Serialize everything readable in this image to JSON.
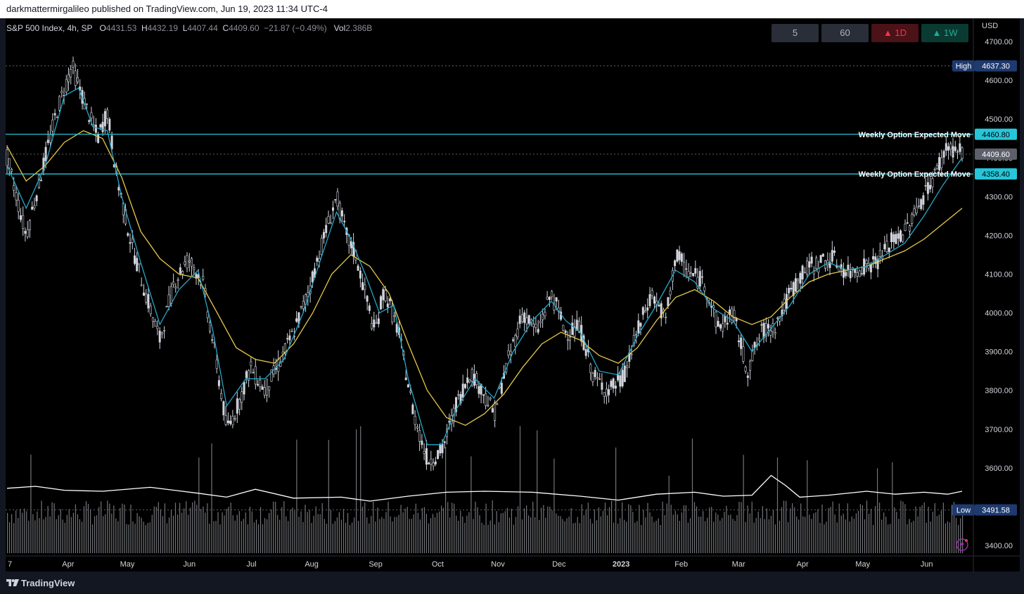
{
  "header": {
    "published_text": "darkmattermirgalileo published on TradingView.com, Jun 19, 2023 11:34 UTC-4"
  },
  "legend": {
    "symbol": "S&P 500 Index, 4h, SP",
    "o_label": "O",
    "o_value": "4431.53",
    "h_label": "H",
    "h_value": "4432.19",
    "l_label": "L",
    "l_value": "4407.44",
    "c_label": "C",
    "c_value": "4409.60",
    "change": "−21.87 (−0.49%)",
    "vol_label": "Vol",
    "vol_value": "2.386B"
  },
  "timeframe_buttons": [
    {
      "label": "5",
      "bg": "#2a2e39",
      "color": "#b2b5be"
    },
    {
      "label": "60",
      "bg": "#2a2e39",
      "color": "#b2b5be"
    },
    {
      "label": "▲ 1D",
      "bg": "#4b1218",
      "color": "#f23645"
    },
    {
      "label": "▲ 1W",
      "bg": "#0b3a33",
      "color": "#22ab94"
    }
  ],
  "currency": "USD",
  "footer": {
    "logo_text": "TradingView"
  },
  "colors": {
    "candle": "#d1d4dc",
    "ema_fast": "#26a6c9",
    "sma_slow": "#e6c84a",
    "expected_move": "#26c6da",
    "volume": "#d1d4dc",
    "volume_ma": "#ffffff"
  },
  "chart_data": {
    "type": "candlestick",
    "title": "S&P 500 Index, 4h, SP",
    "ylim": [
      3380,
      4760
    ],
    "y_ticks": [
      4700,
      4600,
      4500,
      4400,
      4300,
      4200,
      4100,
      4000,
      3900,
      3800,
      3700,
      3600,
      3500,
      3400
    ],
    "y_tick_labels": [
      "4700.00",
      "4600.00",
      "4500.00",
      "4400.00",
      "4300.00",
      "4200.00",
      "4100.00",
      "4000.00",
      "3900.00",
      "3800.00",
      "3700.00",
      "3600.00",
      "3500.00",
      "3400.00"
    ],
    "x_ticks": [
      {
        "label": "7",
        "pos": 0
      },
      {
        "label": "Apr",
        "pos": 0.061
      },
      {
        "label": "May",
        "pos": 0.123
      },
      {
        "label": "Jun",
        "pos": 0.188
      },
      {
        "label": "Jul",
        "pos": 0.253
      },
      {
        "label": "Aug",
        "pos": 0.316
      },
      {
        "label": "Sep",
        "pos": 0.383
      },
      {
        "label": "Oct",
        "pos": 0.448
      },
      {
        "label": "Nov",
        "pos": 0.511
      },
      {
        "label": "Dec",
        "pos": 0.575
      },
      {
        "label": "2023",
        "pos": 0.64,
        "bold": true
      },
      {
        "label": "Feb",
        "pos": 0.703
      },
      {
        "label": "Mar",
        "pos": 0.763
      },
      {
        "label": "Apr",
        "pos": 0.83
      },
      {
        "label": "May",
        "pos": 0.893
      },
      {
        "label": "Jun",
        "pos": 0.96
      }
    ],
    "price_path": [
      [
        0,
        4400
      ],
      [
        0.02,
        4200
      ],
      [
        0.035,
        4350
      ],
      [
        0.052,
        4520
      ],
      [
        0.06,
        4580
      ],
      [
        0.068,
        4637
      ],
      [
        0.08,
        4550
      ],
      [
        0.095,
        4450
      ],
      [
        0.105,
        4520
      ],
      [
        0.115,
        4350
      ],
      [
        0.13,
        4180
      ],
      [
        0.145,
        4050
      ],
      [
        0.16,
        3930
      ],
      [
        0.175,
        4080
      ],
      [
        0.19,
        4140
      ],
      [
        0.205,
        4080
      ],
      [
        0.22,
        3860
      ],
      [
        0.23,
        3700
      ],
      [
        0.24,
        3750
      ],
      [
        0.255,
        3860
      ],
      [
        0.27,
        3800
      ],
      [
        0.285,
        3870
      ],
      [
        0.3,
        3950
      ],
      [
        0.315,
        4050
      ],
      [
        0.33,
        4180
      ],
      [
        0.345,
        4300
      ],
      [
        0.355,
        4200
      ],
      [
        0.365,
        4150
      ],
      [
        0.375,
        4050
      ],
      [
        0.385,
        3950
      ],
      [
        0.395,
        4060
      ],
      [
        0.41,
        3950
      ],
      [
        0.425,
        3750
      ],
      [
        0.44,
        3620
      ],
      [
        0.455,
        3640
      ],
      [
        0.47,
        3760
      ],
      [
        0.485,
        3850
      ],
      [
        0.5,
        3790
      ],
      [
        0.51,
        3740
      ],
      [
        0.525,
        3880
      ],
      [
        0.54,
        4000
      ],
      [
        0.555,
        3950
      ],
      [
        0.57,
        4050
      ],
      [
        0.585,
        3950
      ],
      [
        0.6,
        3960
      ],
      [
        0.615,
        3830
      ],
      [
        0.63,
        3800
      ],
      [
        0.645,
        3830
      ],
      [
        0.66,
        3950
      ],
      [
        0.675,
        4050
      ],
      [
        0.69,
        3980
      ],
      [
        0.7,
        4150
      ],
      [
        0.715,
        4100
      ],
      [
        0.73,
        4080
      ],
      [
        0.745,
        3960
      ],
      [
        0.76,
        4000
      ],
      [
        0.775,
        3850
      ],
      [
        0.79,
        3950
      ],
      [
        0.805,
        3970
      ],
      [
        0.82,
        4050
      ],
      [
        0.835,
        4110
      ],
      [
        0.85,
        4130
      ],
      [
        0.865,
        4140
      ],
      [
        0.88,
        4100
      ],
      [
        0.895,
        4120
      ],
      [
        0.91,
        4130
      ],
      [
        0.925,
        4180
      ],
      [
        0.94,
        4210
      ],
      [
        0.955,
        4280
      ],
      [
        0.97,
        4350
      ],
      [
        0.985,
        4430
      ],
      [
        1.0,
        4410
      ]
    ],
    "ema_path": [
      [
        0,
        4380
      ],
      [
        0.02,
        4270
      ],
      [
        0.04,
        4380
      ],
      [
        0.06,
        4560
      ],
      [
        0.075,
        4580
      ],
      [
        0.09,
        4480
      ],
      [
        0.105,
        4470
      ],
      [
        0.12,
        4300
      ],
      [
        0.14,
        4130
      ],
      [
        0.16,
        3970
      ],
      [
        0.18,
        4060
      ],
      [
        0.2,
        4110
      ],
      [
        0.215,
        3960
      ],
      [
        0.23,
        3760
      ],
      [
        0.25,
        3830
      ],
      [
        0.27,
        3830
      ],
      [
        0.29,
        3880
      ],
      [
        0.31,
        4000
      ],
      [
        0.33,
        4150
      ],
      [
        0.345,
        4260
      ],
      [
        0.36,
        4190
      ],
      [
        0.375,
        4100
      ],
      [
        0.39,
        4000
      ],
      [
        0.405,
        4020
      ],
      [
        0.42,
        3830
      ],
      [
        0.44,
        3660
      ],
      [
        0.455,
        3660
      ],
      [
        0.47,
        3750
      ],
      [
        0.49,
        3830
      ],
      [
        0.51,
        3780
      ],
      [
        0.53,
        3900
      ],
      [
        0.55,
        3980
      ],
      [
        0.57,
        4030
      ],
      [
        0.585,
        3980
      ],
      [
        0.6,
        3950
      ],
      [
        0.62,
        3850
      ],
      [
        0.64,
        3840
      ],
      [
        0.66,
        3940
      ],
      [
        0.68,
        4020
      ],
      [
        0.7,
        4110
      ],
      [
        0.72,
        4080
      ],
      [
        0.74,
        4010
      ],
      [
        0.76,
        3980
      ],
      [
        0.78,
        3900
      ],
      [
        0.8,
        3960
      ],
      [
        0.82,
        4020
      ],
      [
        0.84,
        4100
      ],
      [
        0.86,
        4130
      ],
      [
        0.88,
        4110
      ],
      [
        0.9,
        4120
      ],
      [
        0.92,
        4150
      ],
      [
        0.94,
        4180
      ],
      [
        0.96,
        4250
      ],
      [
        0.98,
        4330
      ],
      [
        1.0,
        4400
      ]
    ],
    "sma_path": [
      [
        0,
        4430
      ],
      [
        0.02,
        4340
      ],
      [
        0.04,
        4380
      ],
      [
        0.06,
        4440
      ],
      [
        0.08,
        4470
      ],
      [
        0.1,
        4450
      ],
      [
        0.12,
        4350
      ],
      [
        0.14,
        4210
      ],
      [
        0.16,
        4140
      ],
      [
        0.18,
        4100
      ],
      [
        0.2,
        4090
      ],
      [
        0.22,
        4000
      ],
      [
        0.24,
        3910
      ],
      [
        0.26,
        3880
      ],
      [
        0.28,
        3870
      ],
      [
        0.3,
        3920
      ],
      [
        0.32,
        4000
      ],
      [
        0.34,
        4100
      ],
      [
        0.36,
        4150
      ],
      [
        0.38,
        4120
      ],
      [
        0.4,
        4050
      ],
      [
        0.42,
        3920
      ],
      [
        0.44,
        3800
      ],
      [
        0.46,
        3730
      ],
      [
        0.48,
        3710
      ],
      [
        0.5,
        3740
      ],
      [
        0.52,
        3790
      ],
      [
        0.54,
        3860
      ],
      [
        0.56,
        3920
      ],
      [
        0.58,
        3950
      ],
      [
        0.6,
        3930
      ],
      [
        0.62,
        3890
      ],
      [
        0.64,
        3870
      ],
      [
        0.66,
        3910
      ],
      [
        0.68,
        3980
      ],
      [
        0.7,
        4040
      ],
      [
        0.72,
        4060
      ],
      [
        0.74,
        4030
      ],
      [
        0.76,
        3990
      ],
      [
        0.78,
        3970
      ],
      [
        0.8,
        3990
      ],
      [
        0.82,
        4040
      ],
      [
        0.84,
        4080
      ],
      [
        0.86,
        4100
      ],
      [
        0.88,
        4110
      ],
      [
        0.9,
        4120
      ],
      [
        0.92,
        4140
      ],
      [
        0.94,
        4160
      ],
      [
        0.96,
        4190
      ],
      [
        0.98,
        4230
      ],
      [
        1.0,
        4270
      ]
    ],
    "horizontal_lines": [
      {
        "price": 4460.8,
        "label": "Weekly Option Expected Move",
        "tag": "4460.80",
        "color": "#26c6da"
      },
      {
        "price": 4358.4,
        "label": "Weekly Option Expected Move",
        "tag": "4358.40",
        "color": "#26c6da"
      }
    ],
    "price_tags": [
      {
        "price": 4637.3,
        "prefix": "High",
        "tag": "4637.30",
        "bg": "#1e3a6e"
      },
      {
        "price": 4409.6,
        "prefix": "",
        "tag": "4409.60",
        "bg": "#5d606b"
      },
      {
        "price": 3491.58,
        "prefix": "Low",
        "tag": "3491.58",
        "bg": "#1e3a6e"
      }
    ],
    "partial_tag": "4400.00",
    "volume_ma_path": [
      [
        0,
        0.46
      ],
      [
        0.03,
        0.5
      ],
      [
        0.06,
        0.42
      ],
      [
        0.1,
        0.4
      ],
      [
        0.15,
        0.48
      ],
      [
        0.2,
        0.36
      ],
      [
        0.23,
        0.28
      ],
      [
        0.26,
        0.44
      ],
      [
        0.3,
        0.26
      ],
      [
        0.35,
        0.28
      ],
      [
        0.38,
        0.2
      ],
      [
        0.42,
        0.3
      ],
      [
        0.46,
        0.38
      ],
      [
        0.5,
        0.4
      ],
      [
        0.55,
        0.38
      ],
      [
        0.6,
        0.3
      ],
      [
        0.64,
        0.22
      ],
      [
        0.68,
        0.34
      ],
      [
        0.72,
        0.38
      ],
      [
        0.75,
        0.3
      ],
      [
        0.78,
        0.32
      ],
      [
        0.8,
        0.72
      ],
      [
        0.815,
        0.52
      ],
      [
        0.83,
        0.28
      ],
      [
        0.86,
        0.32
      ],
      [
        0.9,
        0.4
      ],
      [
        0.93,
        0.34
      ],
      [
        0.96,
        0.38
      ],
      [
        0.985,
        0.34
      ],
      [
        1.0,
        0.4
      ]
    ]
  }
}
